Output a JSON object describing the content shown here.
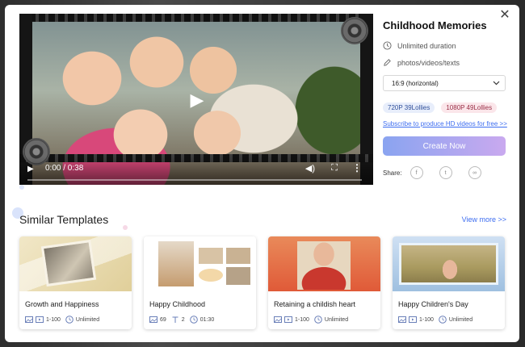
{
  "video": {
    "time": "0:00 / 0:38"
  },
  "template": {
    "title": "Childhood Memories",
    "duration": "Unlimited duration",
    "media": "photos/videos/texts",
    "aspect_selected": "16:9 (horizontal)",
    "badge_720": "720P 39Lollies",
    "badge_1080": "1080P 49Lollies",
    "subscribe_text": "Subscribe to produce HD videos for free >>",
    "create_label": "Create Now",
    "share_label": "Share:"
  },
  "similar": {
    "title": "Similar Templates",
    "view_more": "View more >>",
    "cards": [
      {
        "name": "Growth and Happiness",
        "media_count": "1-100",
        "duration": "Unlimited"
      },
      {
        "name": "Happy Childhood",
        "media_count": "69",
        "text_count": "2",
        "duration": "01:30"
      },
      {
        "name": "Retaining a childish heart",
        "media_count": "1-100",
        "duration": "Unlimited"
      },
      {
        "name": "Happy Children's Day",
        "media_count": "1-100",
        "duration": "Unlimited"
      }
    ]
  },
  "colors": {
    "accent": "#3d6df0",
    "create_gradient_start": "#8aa4f0",
    "create_gradient_end": "#c9a9ef"
  },
  "icons": {
    "close": "close-icon",
    "play": "play-icon",
    "clock": "clock-icon",
    "pencil": "pencil-icon",
    "chevron": "chevron-down-icon",
    "facebook": "facebook-icon",
    "twitter": "twitter-icon",
    "link": "link-icon"
  }
}
